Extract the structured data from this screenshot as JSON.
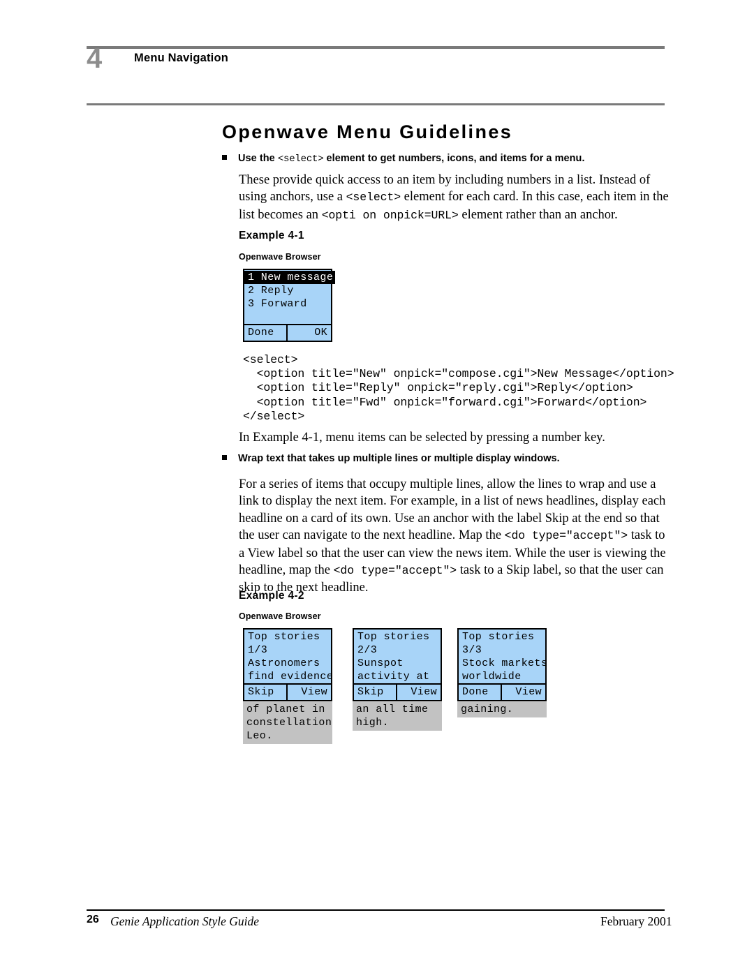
{
  "header": {
    "chapter_number": "4",
    "chapter_title": "Menu Navigation"
  },
  "section": {
    "title": "Openwave Menu Guidelines"
  },
  "bullet1": {
    "text_before": "Use the ",
    "code": "<select>",
    "text_after": " element to get numbers, icons, and items for a menu."
  },
  "paragraph1": {
    "part1": "These provide quick access to an item by including numbers in a list. Instead of using anchors, use a ",
    "code1": "<select>",
    "part2": " element for each card. In this case, each item in the list becomes an ",
    "code2": "<opti on onpick=URL>",
    "part3": " element rather than an anchor."
  },
  "example1": {
    "label": "Example 4-1",
    "browser_label": "Openwave Browser",
    "phone": {
      "lines": [
        "1 New message",
        "2 Reply",
        "3 Forward",
        ""
      ],
      "highlight_index": 0,
      "softkey_left": "Done",
      "softkey_right": "OK"
    },
    "code": "<select>\n  <option title=\"New\" onpick=\"compose.cgi\">New Message</option>\n  <option title=\"Reply\" onpick=\"reply.cgi\">Reply</option>\n  <option title=\"Fwd\" onpick=\"forward.cgi\">Forward</option>\n</select>",
    "caption": "In Example 4-1, menu items can be selected by pressing a number key."
  },
  "bullet2": {
    "text": "Wrap text that takes up multiple lines or multiple display windows."
  },
  "paragraph2": {
    "part1": "For a series of items that occupy multiple lines, allow the lines to wrap and use a link to display the next item. For example, in a list of news headlines, display each headline on a card of its own. Use an anchor with the label Skip at the end so that the user can navigate to the next headline. Map the ",
    "code1": "<do type=\"accept\">",
    "part2": " task to a View label so that the user can view the news item. While the user is viewing the headline, map the ",
    "code2": "<do type=\"accept\">",
    "part3": " task to a Skip label, so that the user can skip to the next headline."
  },
  "example2": {
    "label": "Example 4-2",
    "browser_label": "Openwave Browser",
    "phones": [
      {
        "lines": [
          "Top stories",
          "1/3",
          "Astronomers",
          "find evidence"
        ],
        "softkey_left": "Skip",
        "softkey_right": "View",
        "continuation": [
          "of planet in",
          "constellation",
          "Leo."
        ]
      },
      {
        "lines": [
          "Top stories",
          "2/3",
          "Sunspot",
          "activity at"
        ],
        "softkey_left": "Skip",
        "softkey_right": "View",
        "continuation": [
          "an all time",
          "high."
        ]
      },
      {
        "lines": [
          "Top stories",
          "3/3",
          "Stock markets",
          "worldwide"
        ],
        "softkey_left": "Done",
        "softkey_right": "View",
        "continuation": [
          "gaining."
        ]
      }
    ]
  },
  "footer": {
    "page_number": "26",
    "document_title": "Genie Application Style Guide",
    "date": "February 2001"
  },
  "colors": {
    "screen_blue": "#a8d4f8",
    "continuation_gray": "#c2c2c2",
    "rule_gray": "#7a7a7a",
    "chapter_num_gray": "#8d8d8d"
  }
}
